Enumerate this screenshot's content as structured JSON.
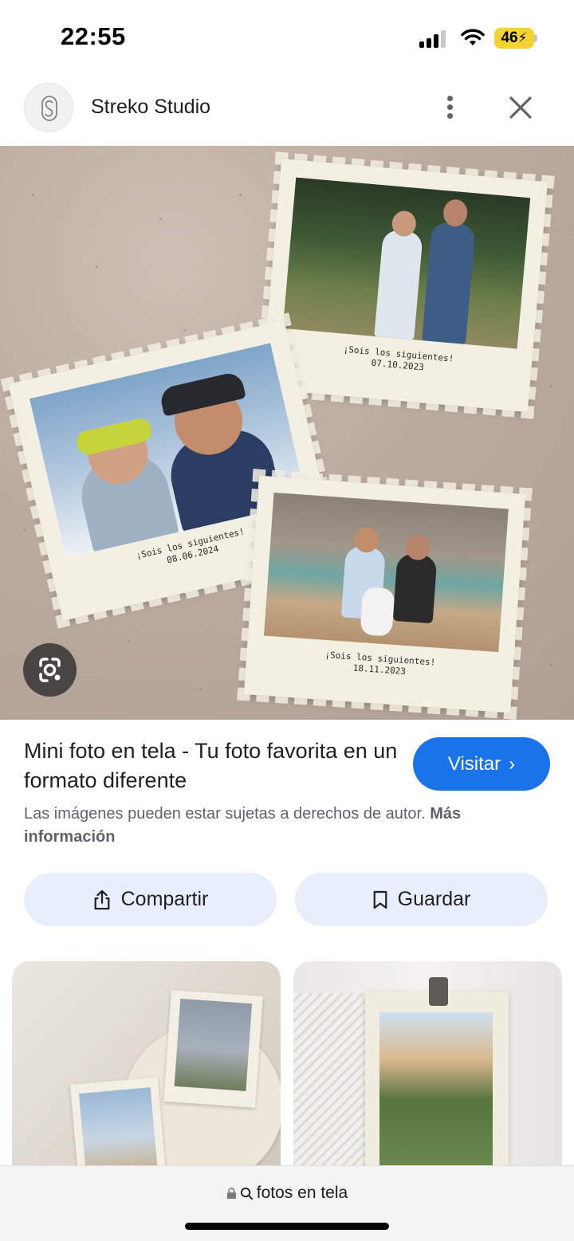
{
  "status_bar": {
    "time": "22:55",
    "battery": "46"
  },
  "source": {
    "name": "Streko Studio"
  },
  "image": {
    "captions": [
      {
        "line1": "¡Sois los siguientes!",
        "line2": "07.10.2023"
      },
      {
        "line1": "¡Sois los siguientes!",
        "line2": "08.06.2024"
      },
      {
        "line1": "¡Sois los siguientes!",
        "line2": "18.11.2023"
      }
    ]
  },
  "result": {
    "title": "Mini foto en tela - Tu foto favorita en un formato diferente",
    "visit_label": "Visitar",
    "copyright_text": "Las imágenes pueden estar sujetas a derechos de autor.",
    "more_info_label": "Más información"
  },
  "actions": {
    "share_label": "Compartir",
    "save_label": "Guardar"
  },
  "search": {
    "query": "fotos en tela"
  },
  "colors": {
    "accent": "#1a73e8",
    "action_bg": "#e8effb",
    "battery": "#f4d234"
  }
}
